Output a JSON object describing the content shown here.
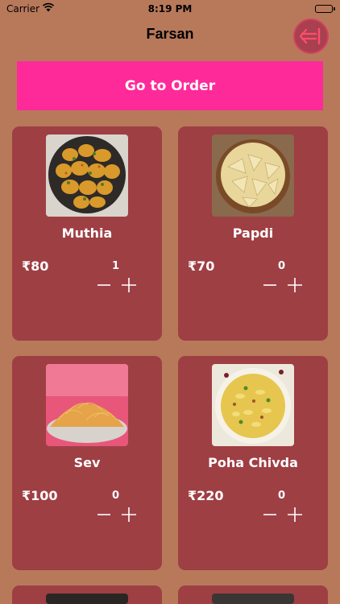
{
  "status_bar": {
    "carrier": "Carrier",
    "time": "8:19 PM"
  },
  "nav": {
    "title": "Farsan",
    "back_icon": "exit-arrow-icon"
  },
  "order_button": {
    "label": "Go to Order"
  },
  "colors": {
    "background": "#b8795b",
    "card": "#9e3f44",
    "order_button": "#fe2a9a",
    "text": "#ffffff"
  },
  "items": [
    {
      "name": "Muthia",
      "price": "₹80",
      "qty": "1"
    },
    {
      "name": "Papdi",
      "price": "₹70",
      "qty": "0"
    },
    {
      "name": "Sev",
      "price": "₹100",
      "qty": "0"
    },
    {
      "name": "Poha Chivda",
      "price": "₹220",
      "qty": "0"
    }
  ]
}
